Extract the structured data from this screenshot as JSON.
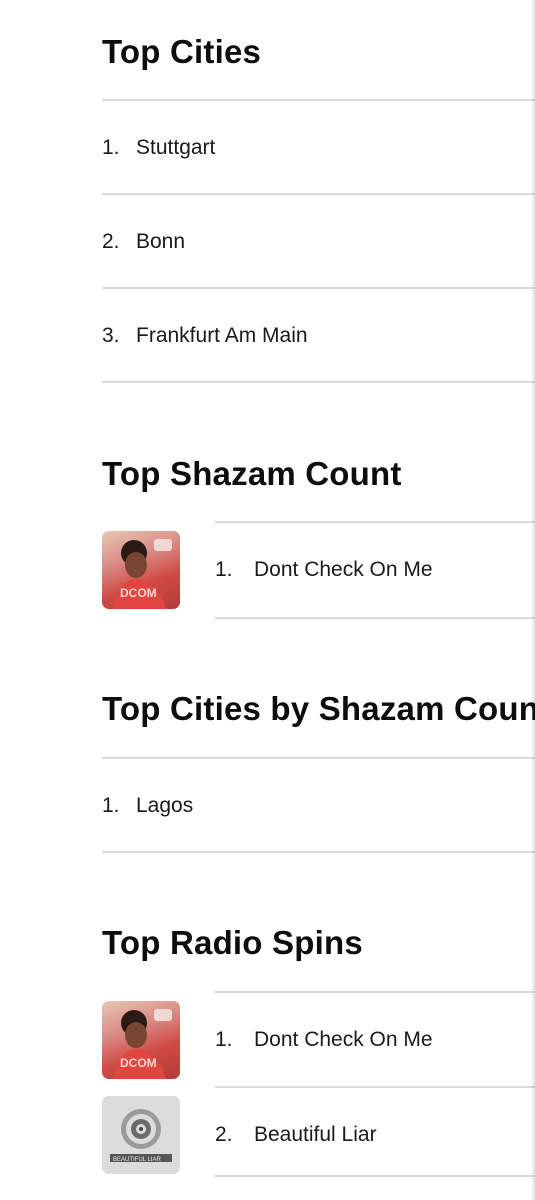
{
  "sections": {
    "top_cities": {
      "title": "Top Cities",
      "items": [
        {
          "rank": "1.",
          "name": "Stuttgart"
        },
        {
          "rank": "2.",
          "name": "Bonn"
        },
        {
          "rank": "3.",
          "name": "Frankfurt Am Main"
        }
      ]
    },
    "top_shazam_count": {
      "title": "Top Shazam Count",
      "items": [
        {
          "rank": "1.",
          "title": "Dont Check On Me",
          "artwork_icon": "album-art-dcom",
          "artwork_text": "DCOM"
        }
      ]
    },
    "top_cities_by_shazam": {
      "title": "Top Cities by Shazam Count",
      "items": [
        {
          "rank": "1.",
          "name": "Lagos"
        }
      ]
    },
    "top_radio_spins": {
      "title": "Top Radio Spins",
      "items": [
        {
          "rank": "1.",
          "title": "Dont Check On Me",
          "artwork_icon": "album-art-dcom",
          "artwork_text": "DCOM"
        },
        {
          "rank": "2.",
          "title": "Beautiful Liar",
          "artwork_icon": "album-art-beautiful-liar",
          "artwork_text": "BEAUTIFUL LIAR"
        }
      ]
    }
  },
  "colors": {
    "divider": "#d9d9d9",
    "text": "#1a1a1a",
    "heading": "#0d0d0d",
    "dcom_art": "#d04a44",
    "liar_art": "#d9d9d9"
  }
}
